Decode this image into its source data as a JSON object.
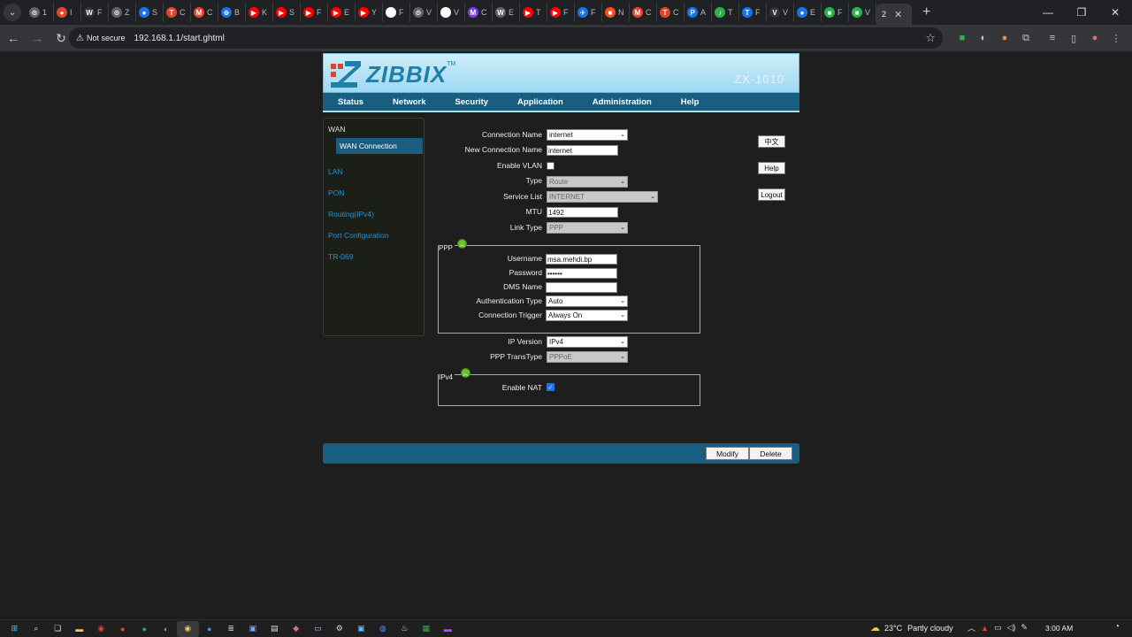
{
  "browser": {
    "tabs": [
      {
        "glyph": "⊙",
        "title": "1",
        "color": "#5f6368"
      },
      {
        "glyph": "●",
        "title": "I",
        "color": "#e0452c"
      },
      {
        "glyph": "W",
        "title": "F",
        "color": "#333333"
      },
      {
        "glyph": "⊙",
        "title": "Z",
        "color": "#5f6368"
      },
      {
        "glyph": "●",
        "title": "S",
        "color": "#1a73e8"
      },
      {
        "glyph": "T",
        "title": "C",
        "color": "#e0452c"
      },
      {
        "glyph": "M",
        "title": "C",
        "color": "#ea4335"
      },
      {
        "glyph": "⊕",
        "title": "B",
        "color": "#1a73e8"
      },
      {
        "glyph": "▶",
        "title": "K",
        "color": "#ff0000"
      },
      {
        "glyph": "▶",
        "title": "S",
        "color": "#ff0000"
      },
      {
        "glyph": "▶",
        "title": "F",
        "color": "#ff0000"
      },
      {
        "glyph": "▶",
        "title": "E",
        "color": "#ff0000"
      },
      {
        "glyph": "▶",
        "title": "Y",
        "color": "#ff0000"
      },
      {
        "glyph": "G",
        "title": "F",
        "color": "#ffffff"
      },
      {
        "glyph": "⊙",
        "title": "V",
        "color": "#5f6368"
      },
      {
        "glyph": "a",
        "title": "V",
        "color": "#ffffff"
      },
      {
        "glyph": "M",
        "title": "C",
        "color": "#7b3fe4"
      },
      {
        "glyph": "W",
        "title": "E",
        "color": "#5f6368"
      },
      {
        "glyph": "▶",
        "title": "T",
        "color": "#ff0000"
      },
      {
        "glyph": "▶",
        "title": "F",
        "color": "#ff0000"
      },
      {
        "glyph": "✈",
        "title": "F",
        "color": "#1a73e8"
      },
      {
        "glyph": "■",
        "title": "N",
        "color": "#f25022"
      },
      {
        "glyph": "M",
        "title": "C",
        "color": "#ea4335"
      },
      {
        "glyph": "T",
        "title": "C",
        "color": "#e0452c"
      },
      {
        "glyph": "P",
        "title": "A",
        "color": "#1a73e8"
      },
      {
        "glyph": "♪",
        "title": "T",
        "color": "#2bb24c"
      },
      {
        "glyph": "T",
        "title": "F",
        "color": "#1a73e8"
      },
      {
        "glyph": "V",
        "title": "V",
        "color": "#333333"
      },
      {
        "glyph": "●",
        "title": "E",
        "color": "#1a73e8"
      },
      {
        "glyph": "■",
        "title": "F",
        "color": "#2bb24c"
      },
      {
        "glyph": "■",
        "title": "V",
        "color": "#2bb24c"
      }
    ],
    "active_tab_title": "2",
    "security_label": "Not secure",
    "url": "192.168.1.1/start.ghtml"
  },
  "router": {
    "brand": "ZIBBIX",
    "trademark": "TM",
    "model": "ZX-1010",
    "menu": [
      "Status",
      "Network",
      "Security",
      "Application",
      "Administration",
      "Help"
    ],
    "sidebar": {
      "section": "WAN",
      "active": "WAN Connection",
      "items": [
        "LAN",
        "PON",
        "Routing(IPv4)",
        "Port Configuration",
        "TR-069"
      ]
    },
    "side_buttons": {
      "lang": "中文",
      "help": "Help",
      "logout": "Logout"
    },
    "form": {
      "connection_name": {
        "label": "Connection Name",
        "value": "internet"
      },
      "new_connection_name": {
        "label": "New Connection Name",
        "value": "internet"
      },
      "enable_vlan": {
        "label": "Enable VLAN",
        "checked": false
      },
      "type": {
        "label": "Type",
        "value": "Route"
      },
      "service_list": {
        "label": "Service List",
        "value": "INTERNET"
      },
      "mtu": {
        "label": "MTU",
        "value": "1492"
      },
      "link_type": {
        "label": "Link Type",
        "value": "PPP"
      },
      "ppp": {
        "legend": "PPP",
        "username": {
          "label": "Username",
          "value": "msa.mehdi.bp"
        },
        "password": {
          "label": "Password",
          "value": "••••••"
        },
        "dms_name": {
          "label": "DMS Name",
          "value": ""
        },
        "auth_type": {
          "label": "Authentication Type",
          "value": "Auto"
        },
        "trigger": {
          "label": "Connection Trigger",
          "value": "Always On"
        }
      },
      "ip_version": {
        "label": "IP Version",
        "value": "IPv4"
      },
      "ppp_transtype": {
        "label": "PPP TransType",
        "value": "PPPoE"
      },
      "ipv4": {
        "legend": "IPv4",
        "enable_nat": {
          "label": "Enable NAT",
          "checked": true
        }
      }
    },
    "footer_buttons": {
      "modify": "Modify",
      "delete": "Delete"
    }
  },
  "taskbar": {
    "weather_temp": "23°C",
    "weather_text": "Partly cloudy",
    "time": "3:00 AM"
  }
}
